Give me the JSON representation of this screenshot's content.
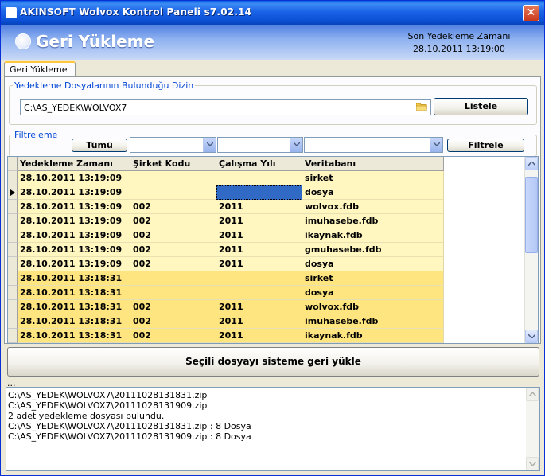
{
  "window": {
    "title": "AKINSOFT Wolvox Kontrol Paneli s7.02.14",
    "close_label": "✕"
  },
  "header": {
    "title": "Geri Yükleme",
    "last_backup_label": "Son Yedekleme Zamanı",
    "last_backup_value": "28.10.2011 13:19:00"
  },
  "tabs": [
    {
      "label": "Geri Yükleme",
      "active": true
    }
  ],
  "directory_group": {
    "label": "Yedekleme Dosyalarının Bulunduğu Dizin",
    "path": "C:\\AS_YEDEK\\WOLVOX7",
    "list_button": "Listele"
  },
  "filter_group": {
    "label": "Filtreleme",
    "all_button": "Tümü",
    "filter_button": "Filtrele",
    "combo1": "",
    "combo2": "",
    "combo3": ""
  },
  "grid": {
    "columns": [
      "Yedekleme Zamanı",
      "Şirket Kodu",
      "Çalışma Yılı",
      "Veritabanı"
    ],
    "rows": [
      [
        "28.10.2011 13:19:09",
        "",
        "",
        "sirket"
      ],
      [
        "28.10.2011 13:19:09",
        "",
        "",
        "dosya"
      ],
      [
        "28.10.2011 13:19:09",
        "002",
        "2011",
        "wolvox.fdb"
      ],
      [
        "28.10.2011 13:19:09",
        "002",
        "2011",
        "imuhasebe.fdb"
      ],
      [
        "28.10.2011 13:19:09",
        "002",
        "2011",
        "ikaynak.fdb"
      ],
      [
        "28.10.2011 13:19:09",
        "002",
        "2011",
        "gmuhasebe.fdb"
      ],
      [
        "28.10.2011 13:19:09",
        "002",
        "2011",
        "dosya"
      ],
      [
        "28.10.2011 13:18:31",
        "",
        "",
        "sirket"
      ],
      [
        "28.10.2011 13:18:31",
        "",
        "",
        "dosya"
      ],
      [
        "28.10.2011 13:18:31",
        "002",
        "2011",
        "wolvox.fdb"
      ],
      [
        "28.10.2011 13:18:31",
        "002",
        "2011",
        "imuhasebe.fdb"
      ],
      [
        "28.10.2011 13:18:31",
        "002",
        "2011",
        "ikaynak.fdb"
      ]
    ],
    "selected_row": 1
  },
  "restore_button": "Seçili dosyayı sisteme geri yükle",
  "log_header": "...",
  "log_lines": [
    "C:\\AS_YEDEK\\WOLVOX7\\20111028131831.zip",
    "C:\\AS_YEDEK\\WOLVOX7\\20111028131909.zip",
    "2 adet yedekleme dosyası bulundu.",
    "C:\\AS_YEDEK\\WOLVOX7\\20111028131831.zip : 8 Dosya",
    "C:\\AS_YEDEK\\WOLVOX7\\20111028131909.zip : 8 Dosya"
  ],
  "colors": {
    "row_light": "#FFF6C0",
    "row_dark": "#FFE580",
    "selection": "#316AC5",
    "group_label": "#0046D5"
  }
}
